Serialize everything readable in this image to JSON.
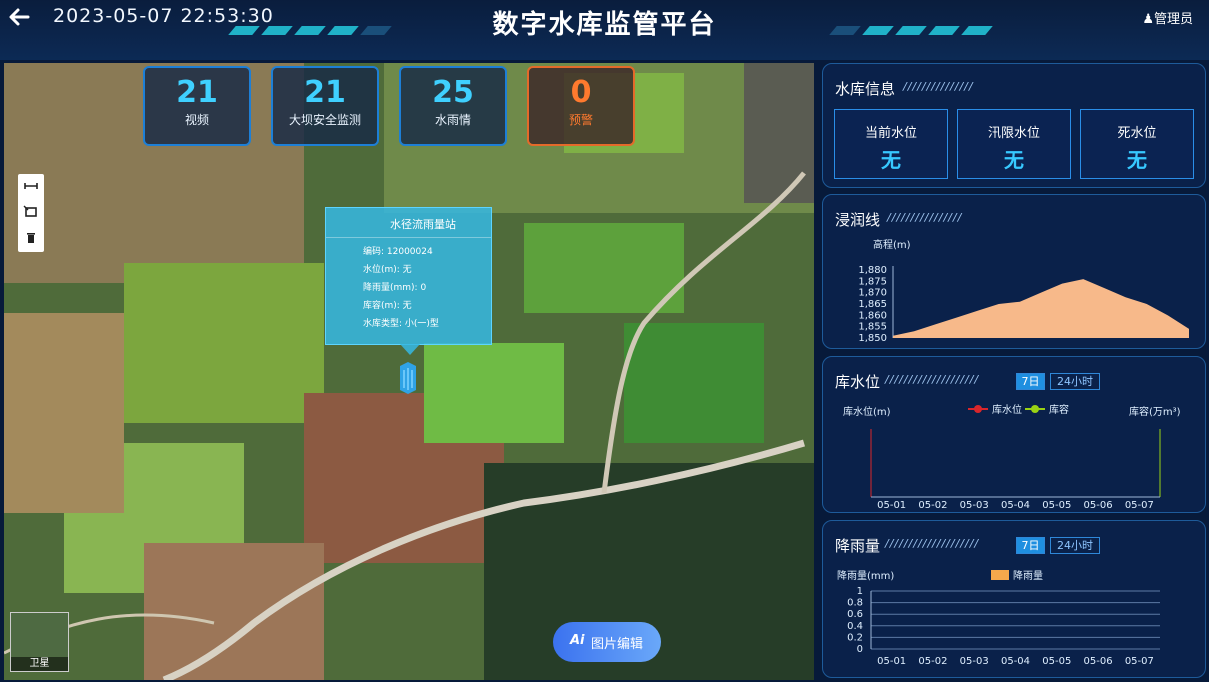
{
  "header": {
    "datetime": "2023-05-07 22:53:30",
    "title": "数字水库监管平台",
    "user": "管理员"
  },
  "stats": [
    {
      "value": "21",
      "label": "视频"
    },
    {
      "value": "21",
      "label": "大坝安全监测"
    },
    {
      "value": "25",
      "label": "水雨情"
    },
    {
      "value": "0",
      "label": "预警"
    }
  ],
  "popup": {
    "title": "水径流雨量站",
    "rows": [
      "编码: 12000024",
      "水位(m): 无",
      "降雨量(mm): 0",
      "库容(m): 无",
      "水库类型: 小(一)型"
    ]
  },
  "map": {
    "layer_label": "卫星",
    "ai_button": "图片编辑",
    "ai_icon": "Ai"
  },
  "reservoir": {
    "title": "水库信息",
    "cards": [
      {
        "label": "当前水位",
        "value": "无"
      },
      {
        "label": "汛限水位",
        "value": "无"
      },
      {
        "label": "死水位",
        "value": "无"
      }
    ]
  },
  "seepage": {
    "title": "浸润线"
  },
  "water_level": {
    "title": "库水位",
    "btn7": "7日",
    "btn24": "24小时"
  },
  "rain": {
    "title": "降雨量",
    "btn7": "7日",
    "btn24": "24小时"
  },
  "chart_data": [
    {
      "type": "area",
      "ylabel": "高程(m)",
      "ylim": [
        1850,
        1880
      ],
      "yticks": [
        "1,880",
        "1,875",
        "1,870",
        "1,865",
        "1,860",
        "1,855",
        "1,850"
      ],
      "x": [
        0,
        1,
        2,
        3,
        4,
        5,
        6,
        7,
        8,
        9,
        10,
        11,
        12,
        13,
        14
      ],
      "values": [
        1851,
        1853,
        1856,
        1859,
        1862,
        1865,
        1866,
        1870,
        1874,
        1876,
        1872,
        1868,
        1865,
        1860,
        1854
      ],
      "color": "#f7b98a"
    },
    {
      "type": "line",
      "ylabel": "库水位(m)",
      "y2label": "库容(万m³)",
      "categories": [
        "05-01",
        "05-02",
        "05-03",
        "05-04",
        "05-05",
        "05-06",
        "05-07"
      ],
      "series": [
        {
          "name": "库水位",
          "values": [],
          "color": "#d9262b"
        },
        {
          "name": "库容",
          "values": [],
          "color": "#9ad214"
        }
      ]
    },
    {
      "type": "bar",
      "ylabel": "降雨量(mm)",
      "categories": [
        "05-01",
        "05-02",
        "05-03",
        "05-04",
        "05-05",
        "05-06",
        "05-07"
      ],
      "series": [
        {
          "name": "降雨量",
          "values": [
            0,
            0,
            0,
            0,
            0,
            0,
            0
          ],
          "color": "#f5a84c"
        }
      ],
      "ylim": [
        0,
        1
      ],
      "yticks": [
        "1",
        "0.8",
        "0.6",
        "0.4",
        "0.2",
        "0"
      ]
    }
  ]
}
